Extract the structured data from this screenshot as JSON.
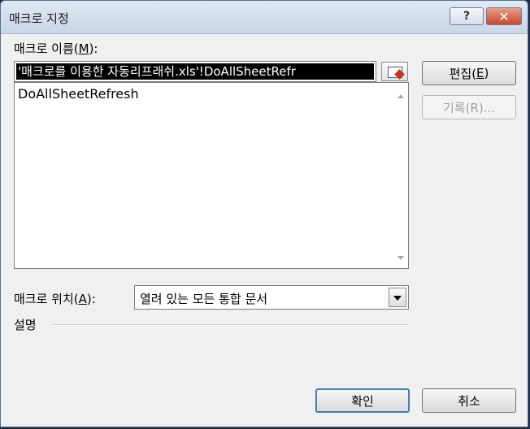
{
  "window": {
    "title": "매크로 지정",
    "help_glyph": "?",
    "close_glyph": "✕"
  },
  "macro_name": {
    "label_text": "매크로 이름(",
    "label_mnemonic": "M",
    "label_suffix": "):",
    "value": "'매크로를 이용한 자동리프래쉬.xls'!DoAllSheetRefr"
  },
  "macro_list": {
    "items": [
      "DoAllSheetRefresh"
    ]
  },
  "buttons": {
    "edit_prefix": "편집(",
    "edit_mnemonic": "E",
    "edit_suffix": ")",
    "record": "기록(R)...",
    "ok": "확인",
    "cancel": "취소"
  },
  "macro_location": {
    "label_text": "매크로 위치(",
    "label_mnemonic": "A",
    "label_suffix": "):",
    "selected": "열려 있는 모든 통합 문서"
  },
  "description": {
    "label": "설명"
  },
  "icons": {
    "pick_range": "range-picker-icon",
    "help": "help-icon",
    "close": "close-icon",
    "dropdown": "chevron-down-icon"
  }
}
